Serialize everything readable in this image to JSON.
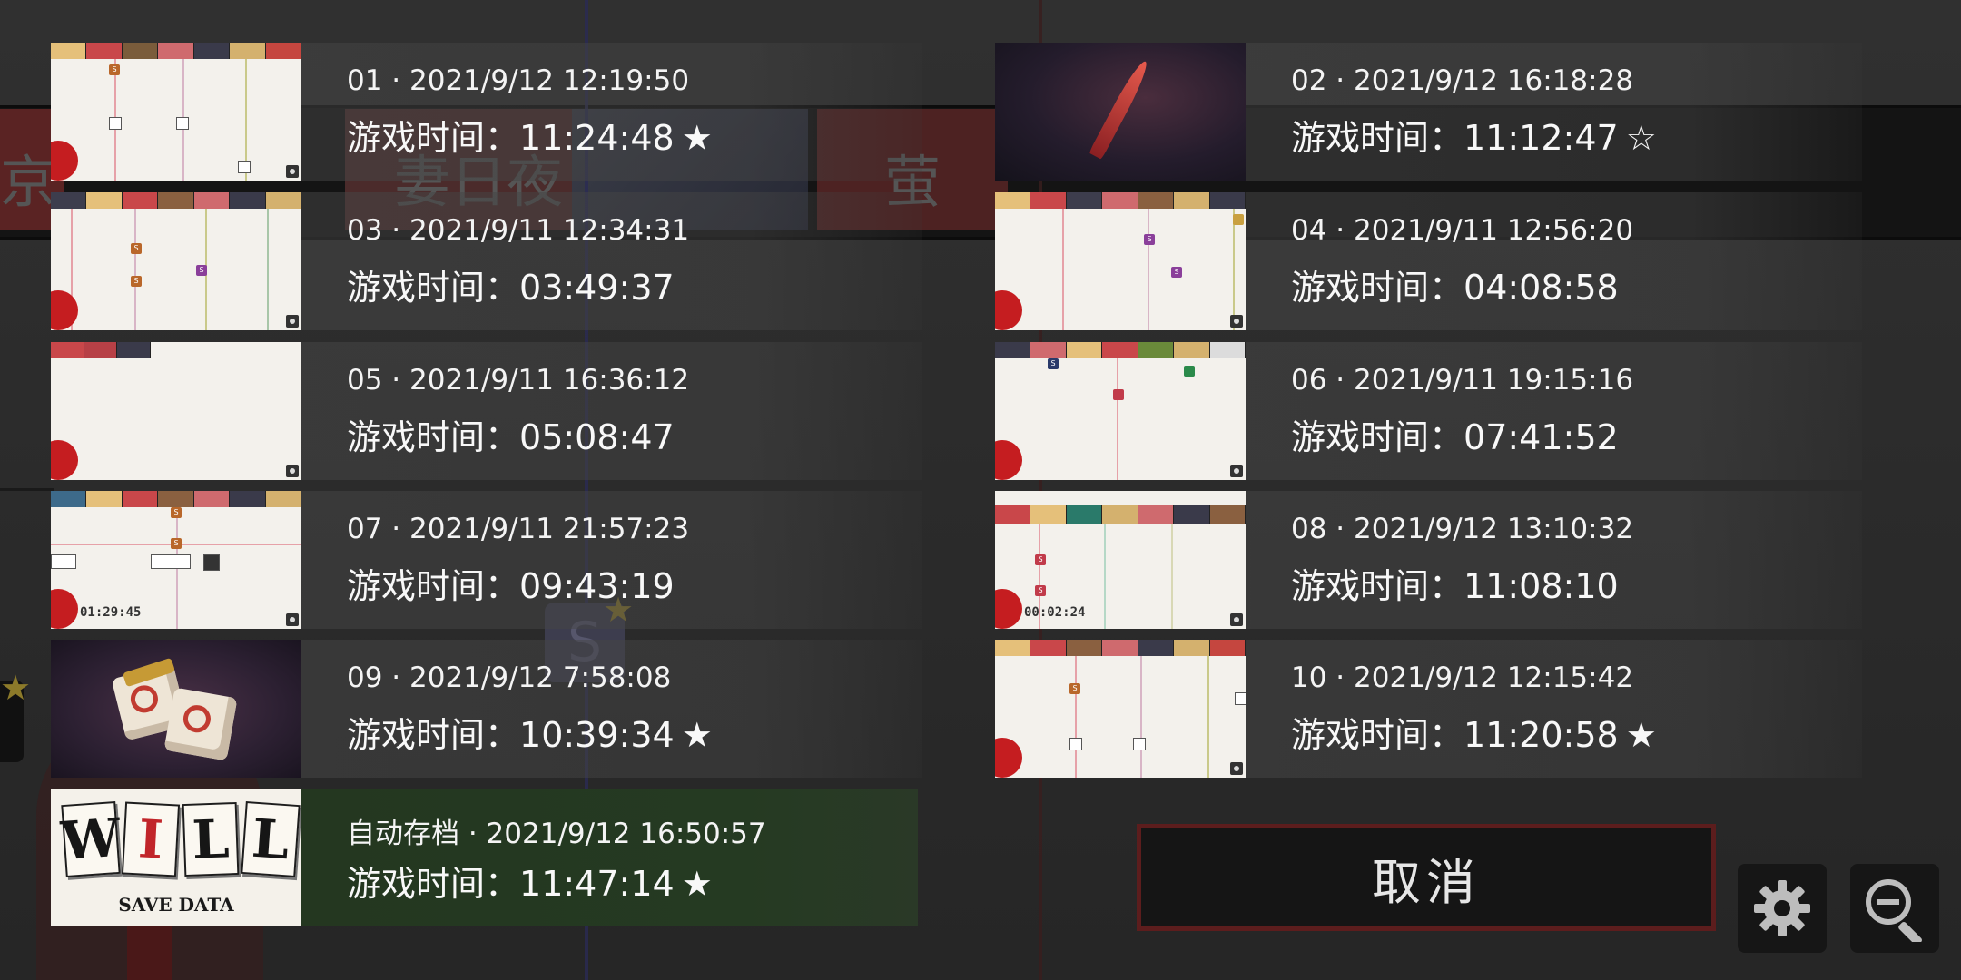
{
  "background": {
    "names": [
      "京",
      "妻日夜",
      "萤"
    ]
  },
  "slots": [
    {
      "line1": "01 · 2021/9/12 12:19:50",
      "line2_label": "游戏时间：",
      "playtime": "11:24:48",
      "star": "★",
      "timer": ""
    },
    {
      "line1": "02 · 2021/9/12 16:18:28",
      "line2_label": "游戏时间：",
      "playtime": "11:12:47",
      "star": "☆",
      "timer": ""
    },
    {
      "line1": "03 · 2021/9/11 12:34:31",
      "line2_label": "游戏时间：",
      "playtime": "03:49:37",
      "star": "",
      "timer": ""
    },
    {
      "line1": "04 · 2021/9/11 12:56:20",
      "line2_label": "游戏时间：",
      "playtime": "04:08:58",
      "star": "",
      "timer": ""
    },
    {
      "line1": "05 · 2021/9/11 16:36:12",
      "line2_label": "游戏时间：",
      "playtime": "05:08:47",
      "star": "",
      "timer": ""
    },
    {
      "line1": "06 · 2021/9/11 19:15:16",
      "line2_label": "游戏时间：",
      "playtime": "07:41:52",
      "star": "",
      "timer": ""
    },
    {
      "line1": "07 · 2021/9/11 21:57:23",
      "line2_label": "游戏时间：",
      "playtime": "09:43:19",
      "star": "",
      "timer": "01:29:45"
    },
    {
      "line1": "08 · 2021/9/12 13:10:32",
      "line2_label": "游戏时间：",
      "playtime": "11:08:10",
      "star": "",
      "timer": "00:02:24"
    },
    {
      "line1": "09 · 2021/9/12 7:58:08",
      "line2_label": "游戏时间：",
      "playtime": "10:39:34",
      "star": "★",
      "timer": ""
    },
    {
      "line1": "10 · 2021/9/12 12:15:42",
      "line2_label": "游戏时间：",
      "playtime": "11:20:58",
      "star": "★",
      "timer": ""
    }
  ],
  "autosave": {
    "line1": "自动存档 · 2021/9/12 16:50:57",
    "line2_label": "游戏时间：",
    "playtime": "11:47:14",
    "star": "★",
    "logo_letters": [
      "W",
      "I",
      "L",
      "L"
    ],
    "logo_sub": "SAVE DATA"
  },
  "buttons": {
    "cancel": "取消",
    "settings_icon": "gear-icon",
    "zoom_icon": "zoom-out-icon"
  },
  "colors": {
    "autosave_bg": "#253a22",
    "cancel_border": "#5c1d1d",
    "post_red": "#c51d20"
  }
}
